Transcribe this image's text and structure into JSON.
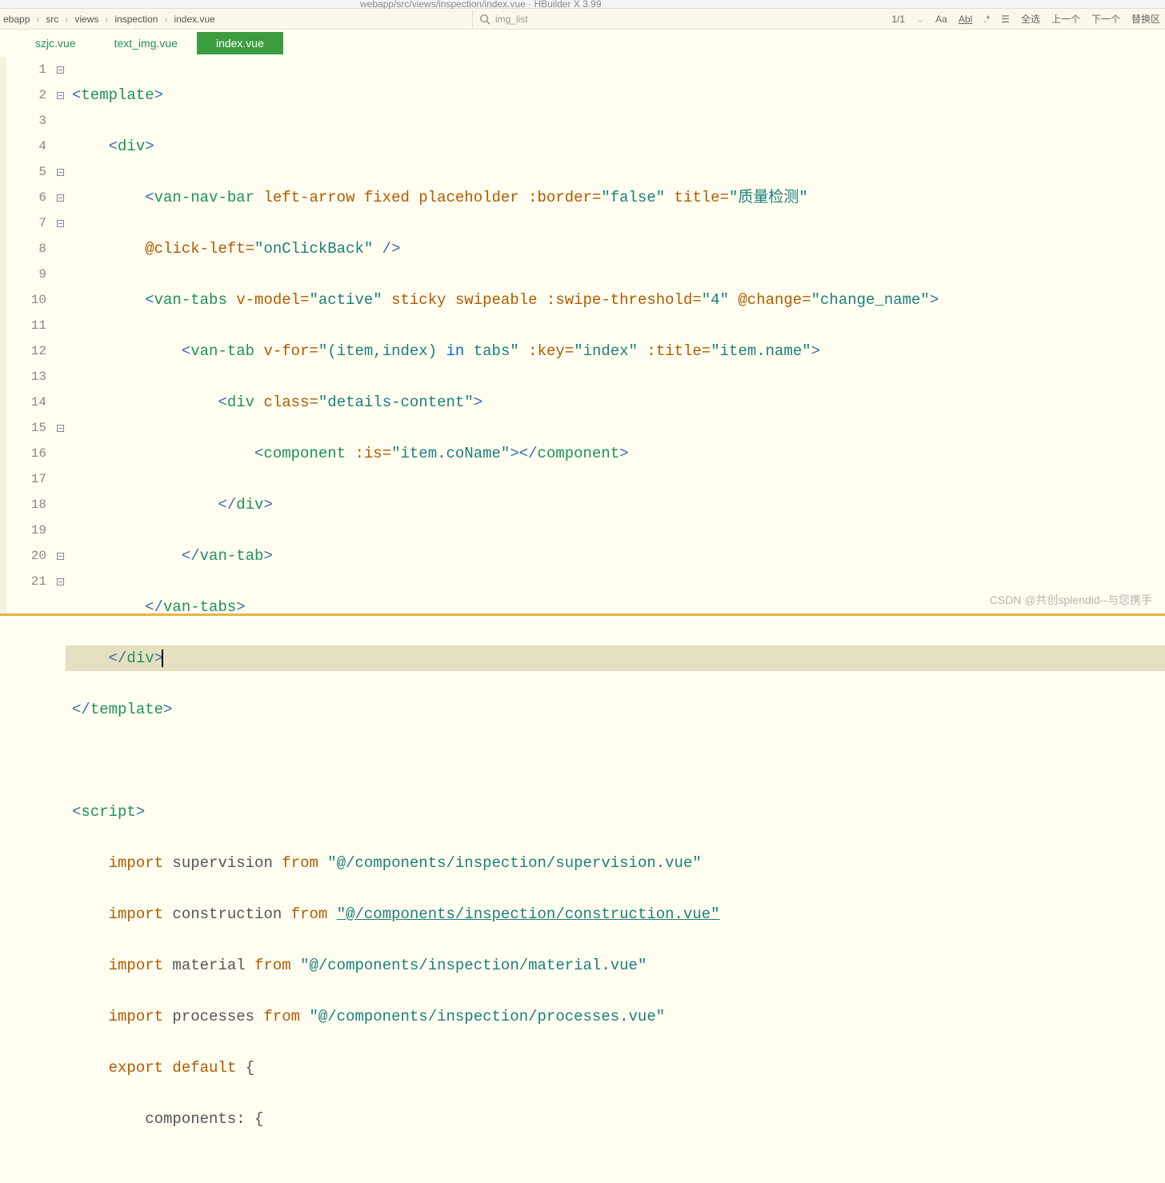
{
  "title_file": "webapp/src/views/inspection/index.vue · HBuilder X 3.99",
  "breadcrumb": [
    "ebapp",
    "src",
    "views",
    "inspection",
    "index.vue"
  ],
  "search": {
    "placeholder": "",
    "value": "img_list"
  },
  "search_info": "1/1",
  "search_tools": [
    "Aa",
    "Abl",
    ".*",
    "全选",
    "上一个",
    "下一个",
    "替换区"
  ],
  "tabs": [
    {
      "label": "szjc.vue",
      "active": false
    },
    {
      "label": "text_img.vue",
      "active": false
    },
    {
      "label": "index.vue",
      "active": true
    }
  ],
  "code": {
    "l1": {
      "indent": "",
      "open": "<",
      "tag": "template",
      "close": ">"
    },
    "l2": {
      "indent": "    ",
      "open": "<",
      "tag": "div",
      "close": ">"
    },
    "l3": {
      "indent": "        ",
      "open": "<",
      "tag": "van-nav-bar",
      "attrs": " left-arrow fixed placeholder ",
      "attr2": ":border=",
      "str2": "\"false\"",
      "attr3": " title=",
      "str3": "\"质量检测\""
    },
    "l4": {
      "indent": "        ",
      "attr": "@click-left=",
      "str": "\"onClickBack\"",
      "close": " />"
    },
    "l5": {
      "indent": "        ",
      "open": "<",
      "tag": "van-tabs",
      "attr1": " v-model=",
      "str1": "\"active\"",
      "attrs": " sticky swipeable ",
      "attr2": ":swipe-threshold=",
      "str2": "\"4\"",
      "attr3": " @change=",
      "str3": "\"change_name\"",
      "close": ">"
    },
    "l6": {
      "indent": "            ",
      "open": "<",
      "tag": "van-tab",
      "attr1": " v-for=",
      "str1a": "\"(item,index) ",
      "kw": "in",
      "str1b": " tabs\"",
      "attr2": " :key=",
      "str2": "\"index\"",
      "attr3": " :title=",
      "str3": "\"item.name\"",
      "close": ">"
    },
    "l7": {
      "indent": "                ",
      "open": "<",
      "tag": "div",
      "attr": " class=",
      "str": "\"details-content\"",
      "close": ">"
    },
    "l8": {
      "indent": "                    ",
      "open": "<",
      "tag": "component",
      "attr": " :is=",
      "str": "\"item.coName\"",
      "mid": "></",
      "tag2": "component",
      "close": ">"
    },
    "l9": {
      "indent": "                ",
      "open": "</",
      "tag": "div",
      "close": ">"
    },
    "l10": {
      "indent": "            ",
      "open": "</",
      "tag": "van-tab",
      "close": ">"
    },
    "l11": {
      "indent": "        ",
      "open": "</",
      "tag": "van-tabs",
      "close": ">"
    },
    "l12": {
      "indent": "    ",
      "open": "</",
      "tag": "div",
      "close": ">"
    },
    "l13": {
      "indent": "",
      "open": "</",
      "tag": "template",
      "close": ">"
    },
    "l15": {
      "indent": "",
      "open": "<",
      "tag": "script",
      "close": ">"
    },
    "l16": {
      "indent": "    ",
      "kw": "import",
      "name": " supervision ",
      "kw2": "from",
      "str": " \"@/components/inspection/supervision.vue\""
    },
    "l17": {
      "indent": "    ",
      "kw": "import",
      "name": " construction ",
      "kw2": "from ",
      "str": "\"@/components/inspection/construction.vue\""
    },
    "l18": {
      "indent": "    ",
      "kw": "import",
      "name": " material ",
      "kw2": "from",
      "str": " \"@/components/inspection/material.vue\""
    },
    "l19": {
      "indent": "    ",
      "kw": "import",
      "name": " processes ",
      "kw2": "from",
      "str": " \"@/components/inspection/processes.vue\""
    },
    "l20": {
      "indent": "    ",
      "kw": "export default",
      "rest": " {"
    },
    "l21": {
      "indent": "        ",
      "name": "components",
      "rest": ": {"
    }
  },
  "watermark": "CSDN @共创splendid--与您携手"
}
